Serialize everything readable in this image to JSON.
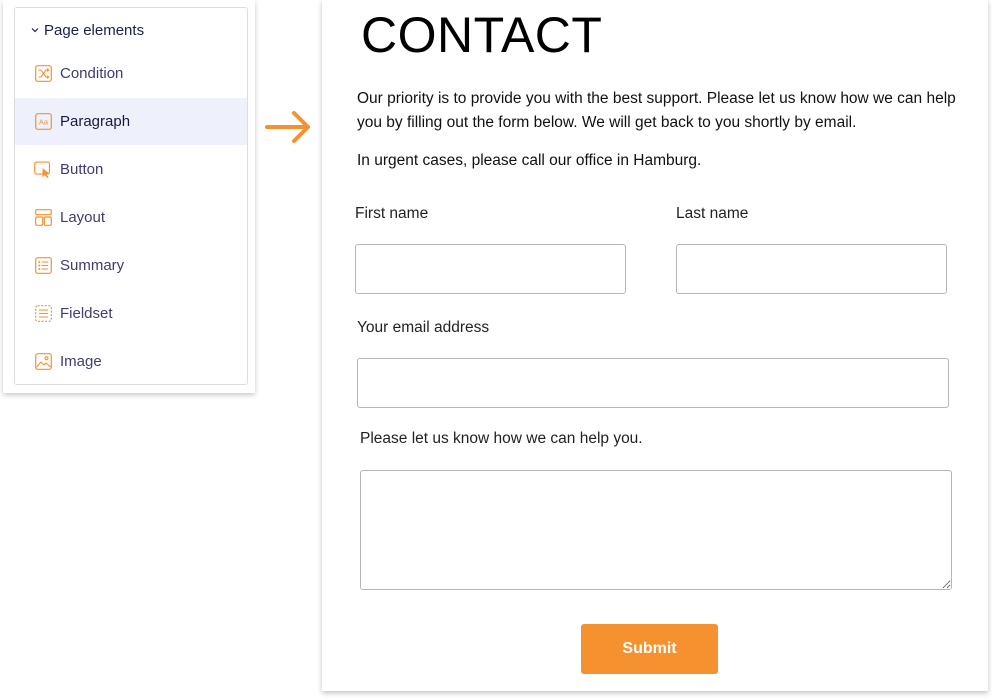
{
  "sidebar": {
    "header": "Page elements",
    "items": [
      {
        "label": "Condition",
        "icon": "condition-icon"
      },
      {
        "label": "Paragraph",
        "icon": "paragraph-icon",
        "active": true
      },
      {
        "label": "Button",
        "icon": "button-icon"
      },
      {
        "label": "Layout",
        "icon": "layout-icon"
      },
      {
        "label": "Summary",
        "icon": "summary-icon"
      },
      {
        "label": "Fieldset",
        "icon": "fieldset-icon"
      },
      {
        "label": "Image",
        "icon": "image-icon"
      }
    ]
  },
  "colors": {
    "accent": "#f5922f",
    "active_bg": "#eef0fb",
    "label_text": "#3e3c72"
  },
  "form": {
    "heading": "CONTACT",
    "intro": "Our priority is to provide you with the best support. Please let us know how we can help you by filling out the form below. We will get back to you shortly by email.",
    "urgent": "In urgent cases, please call our office in Hamburg.",
    "first_name_label": "First name",
    "first_name_value": "",
    "last_name_label": "Last name",
    "last_name_value": "",
    "email_label": "Your email address",
    "email_value": "",
    "help_label": "Please let us know how we can help you.",
    "help_value": "",
    "submit_label": "Submit"
  }
}
